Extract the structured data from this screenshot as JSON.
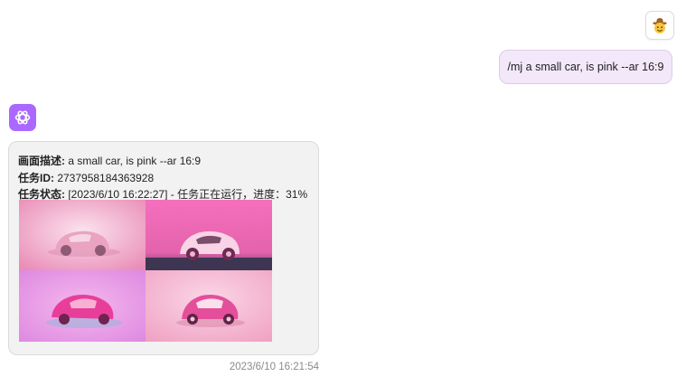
{
  "chat": {
    "user_message": {
      "text": "/mj a small car, is pink --ar 16:9",
      "avatar_icon": "cowboy-emoji-icon"
    },
    "bot_message": {
      "avatar_icon": "openai-logo-icon",
      "avatar_color": "#ab68ff",
      "desc_label": "画面描述:",
      "desc_value": " a small car, is pink --ar 16:9",
      "task_id_label": "任务ID:",
      "task_id_value": " 2737958184363928",
      "status_label": "任务状态:",
      "status_value": " [2023/6/10 16:22:27] - 任务正在运行，进度：31%",
      "progress_percent": 31,
      "images": [
        {
          "name": "generated-image-1",
          "bg": "#f3bfd6"
        },
        {
          "name": "generated-image-2",
          "bg": "#ee6fb8"
        },
        {
          "name": "generated-image-3",
          "bg": "#e99ce7"
        },
        {
          "name": "generated-image-4",
          "bg": "#f4aeca"
        }
      ],
      "timestamp": "2023/6/10 16:21:54"
    }
  }
}
